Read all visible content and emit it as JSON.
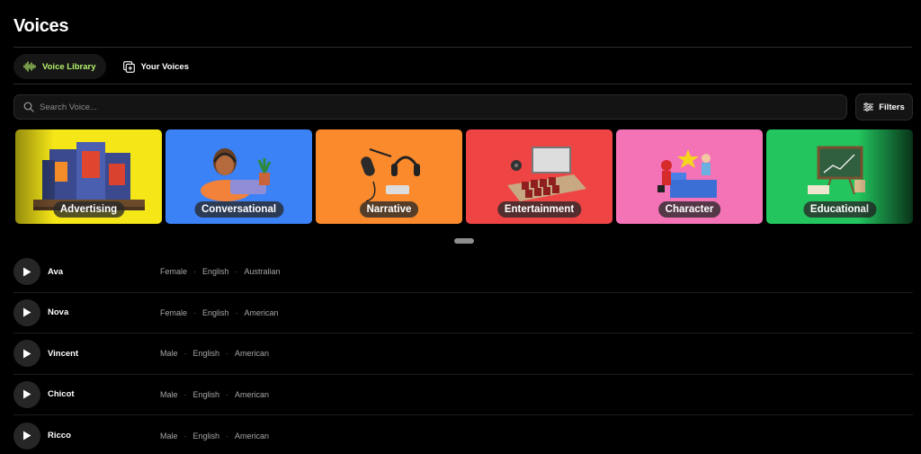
{
  "page": {
    "title": "Voices"
  },
  "tabs": [
    {
      "label": "Voice Library",
      "icon": "waveform-icon",
      "active": true
    },
    {
      "label": "Your Voices",
      "icon": "add-square-icon",
      "active": false
    }
  ],
  "search": {
    "placeholder": "Search Voice...",
    "value": ""
  },
  "filters": {
    "label": "Filters",
    "icon": "sliders-icon"
  },
  "categories": [
    {
      "label": "Advertising",
      "color": "#f5e617"
    },
    {
      "label": "Conversational",
      "color": "#3b82f6"
    },
    {
      "label": "Narrative",
      "color": "#fb8a2c"
    },
    {
      "label": "Entertainment",
      "color": "#ef4444"
    },
    {
      "label": "Character",
      "color": "#f472b6"
    },
    {
      "label": "Educational",
      "color": "#22c55e"
    }
  ],
  "voices": [
    {
      "name": "Ava",
      "gender": "Female",
      "language": "English",
      "accent": "Australian"
    },
    {
      "name": "Nova",
      "gender": "Female",
      "language": "English",
      "accent": "American"
    },
    {
      "name": "Vincent",
      "gender": "Male",
      "language": "English",
      "accent": "American"
    },
    {
      "name": "Chicot",
      "gender": "Male",
      "language": "English",
      "accent": "American"
    },
    {
      "name": "Ricco",
      "gender": "Male",
      "language": "English",
      "accent": "American"
    }
  ],
  "separator": "·",
  "colors": {
    "accent": "#b4f16c",
    "background": "#000000",
    "surface": "#141414"
  }
}
